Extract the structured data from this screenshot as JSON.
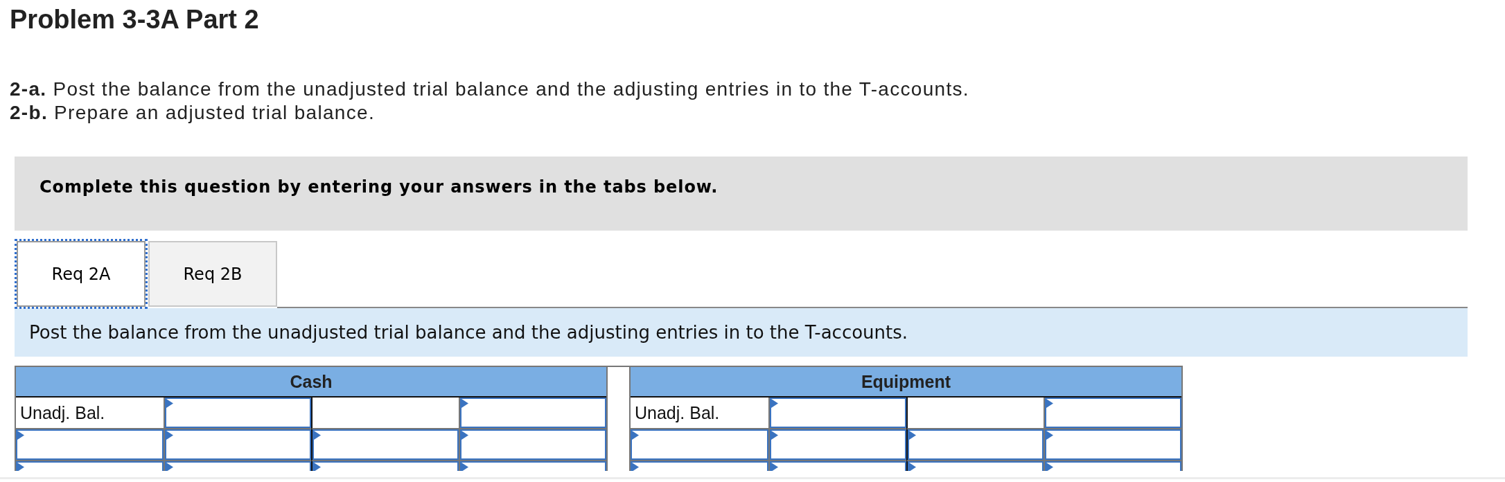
{
  "title": "Problem 3-3A Part 2",
  "instructions": [
    "**2-a.** Post the balance from the unadjusted trial balance and the adjusting entries in to the T-accounts.",
    "**2-b.** Prepare an adjusted trial balance."
  ],
  "notice": "Complete this question by entering your answers in the tabs below.",
  "tabs": [
    {
      "label": "Req 2A",
      "selected": true
    },
    {
      "label": "Req 2B",
      "selected": false
    }
  ],
  "tab_panel": {
    "prompt": "Post the balance from the unadjusted trial balance and the adjusting entries in to the T-accounts.",
    "t_accounts": [
      {
        "title": "Cash",
        "rows": [
          {
            "cells": [
              {
                "kind": "label",
                "text": "Unadj. Bal."
              },
              {
                "kind": "input"
              },
              {
                "kind": "blank"
              },
              {
                "kind": "input"
              }
            ]
          },
          {
            "cells": [
              {
                "kind": "input"
              },
              {
                "kind": "input"
              },
              {
                "kind": "input"
              },
              {
                "kind": "input"
              }
            ]
          },
          {
            "cells": [
              {
                "kind": "input"
              },
              {
                "kind": "input"
              },
              {
                "kind": "input"
              },
              {
                "kind": "input"
              }
            ]
          }
        ]
      },
      {
        "title": "Equipment",
        "rows": [
          {
            "cells": [
              {
                "kind": "label",
                "text": "Unadj. Bal."
              },
              {
                "kind": "input"
              },
              {
                "kind": "blank"
              },
              {
                "kind": "input"
              }
            ]
          },
          {
            "cells": [
              {
                "kind": "input"
              },
              {
                "kind": "input"
              },
              {
                "kind": "input"
              },
              {
                "kind": "input"
              }
            ]
          },
          {
            "cells": [
              {
                "kind": "input"
              },
              {
                "kind": "input"
              },
              {
                "kind": "input"
              },
              {
                "kind": "input"
              }
            ]
          }
        ]
      }
    ]
  }
}
